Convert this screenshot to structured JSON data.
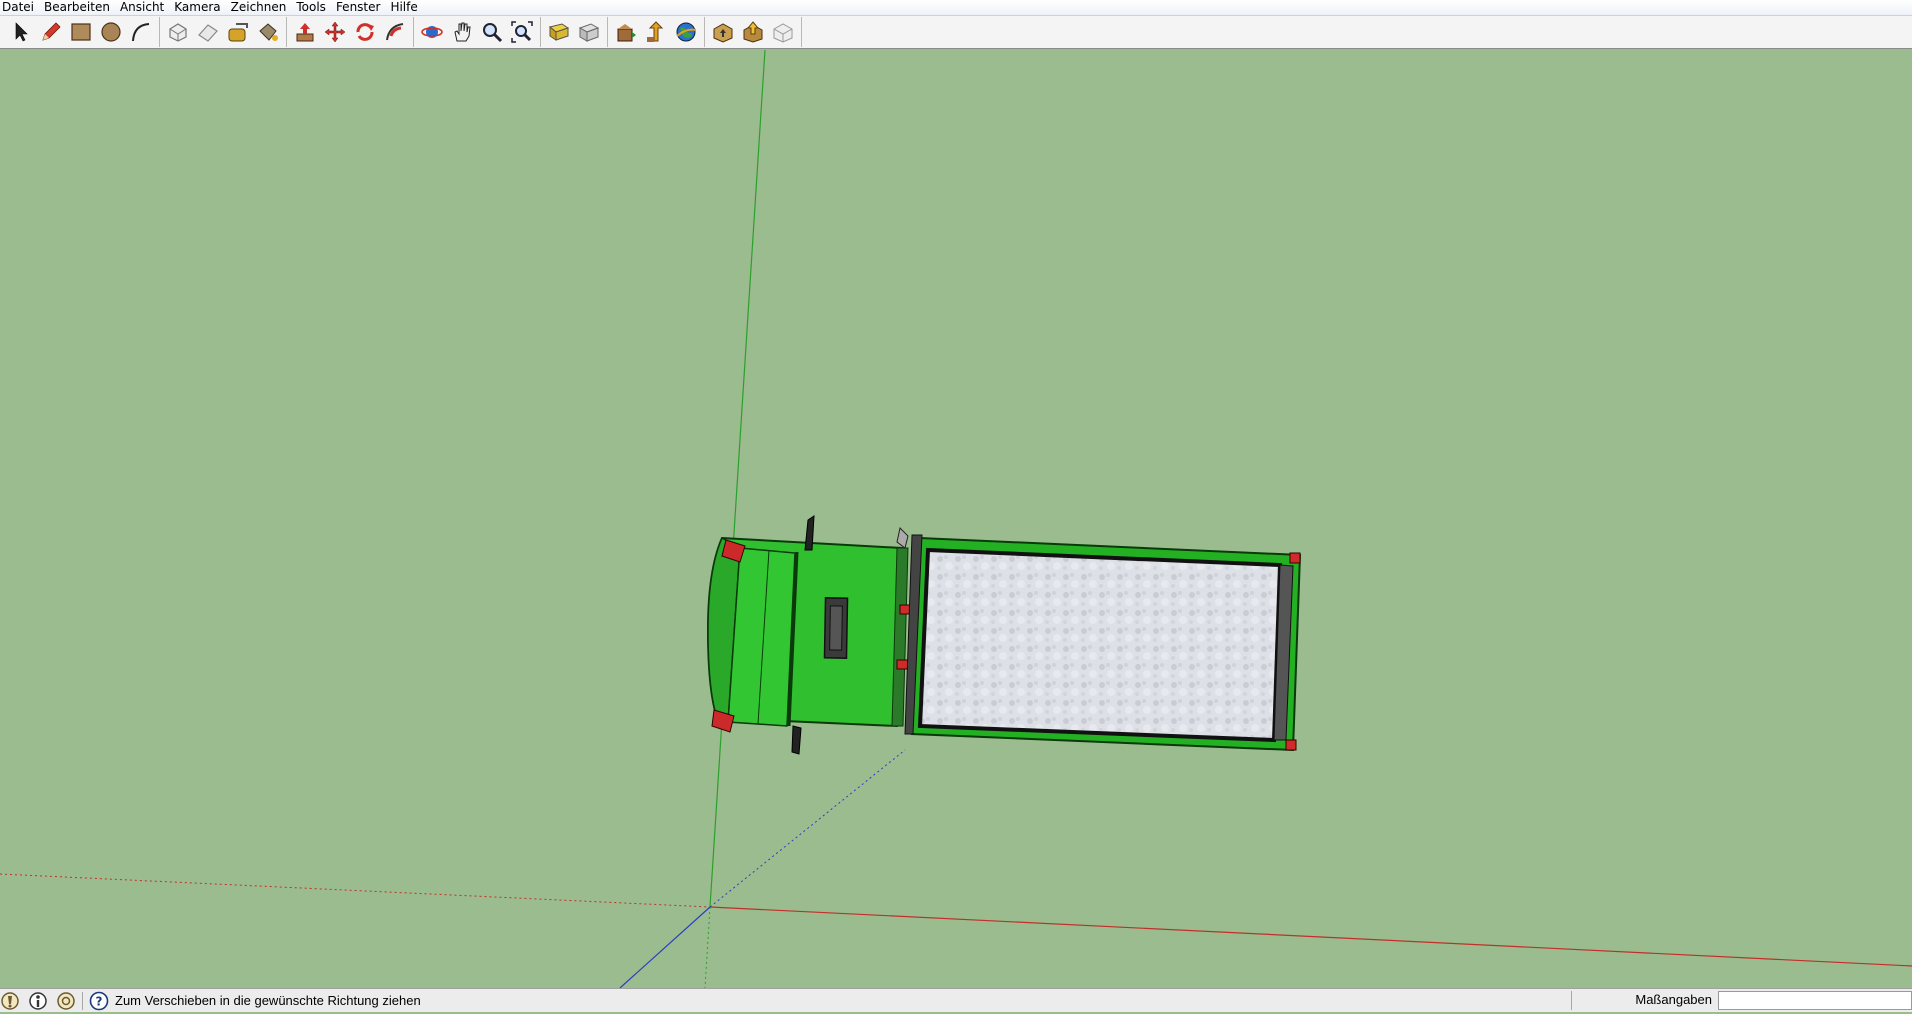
{
  "menu": {
    "items": [
      "Datei",
      "Bearbeiten",
      "Ansicht",
      "Kamera",
      "Zeichnen",
      "Tools",
      "Fenster",
      "Hilfe"
    ]
  },
  "toolbar": {
    "groups": [
      [
        "select-tool",
        "pencil-line-tool",
        "rectangle-tool",
        "circle-tool",
        "arc-tool"
      ],
      [
        "make-component-tool",
        "eraser-tool",
        "tape-measure-tool",
        "paint-bucket-tool"
      ],
      [
        "push-pull-tool",
        "move-tool",
        "rotate-tool",
        "follow-me-tool"
      ],
      [
        "orbit-tool",
        "pan-tool",
        "zoom-tool",
        "zoom-extents-tool"
      ],
      [
        "add-location-tool",
        "toggle-terrain-tool"
      ],
      [
        "get-models-tool",
        "share-model-tool",
        "google-earth-tool"
      ],
      [
        "get-photo-texture-tool",
        "upload-tool",
        "extension-warehouse-tool"
      ]
    ]
  },
  "viewport": {
    "background": "#9bbc8f",
    "axis_colors": {
      "red": "#c0302a",
      "green": "#2ca02c",
      "blue": "#2a3fbf"
    },
    "model": "truck (top view)"
  },
  "status": {
    "icons": [
      "geo-location-icon",
      "credits-icon",
      "user-icon"
    ],
    "help_icon": "help-icon",
    "message": "Zum Verschieben in die gewünschte Richtung ziehen",
    "measure_label": "Maßangaben",
    "measure_value": ""
  }
}
